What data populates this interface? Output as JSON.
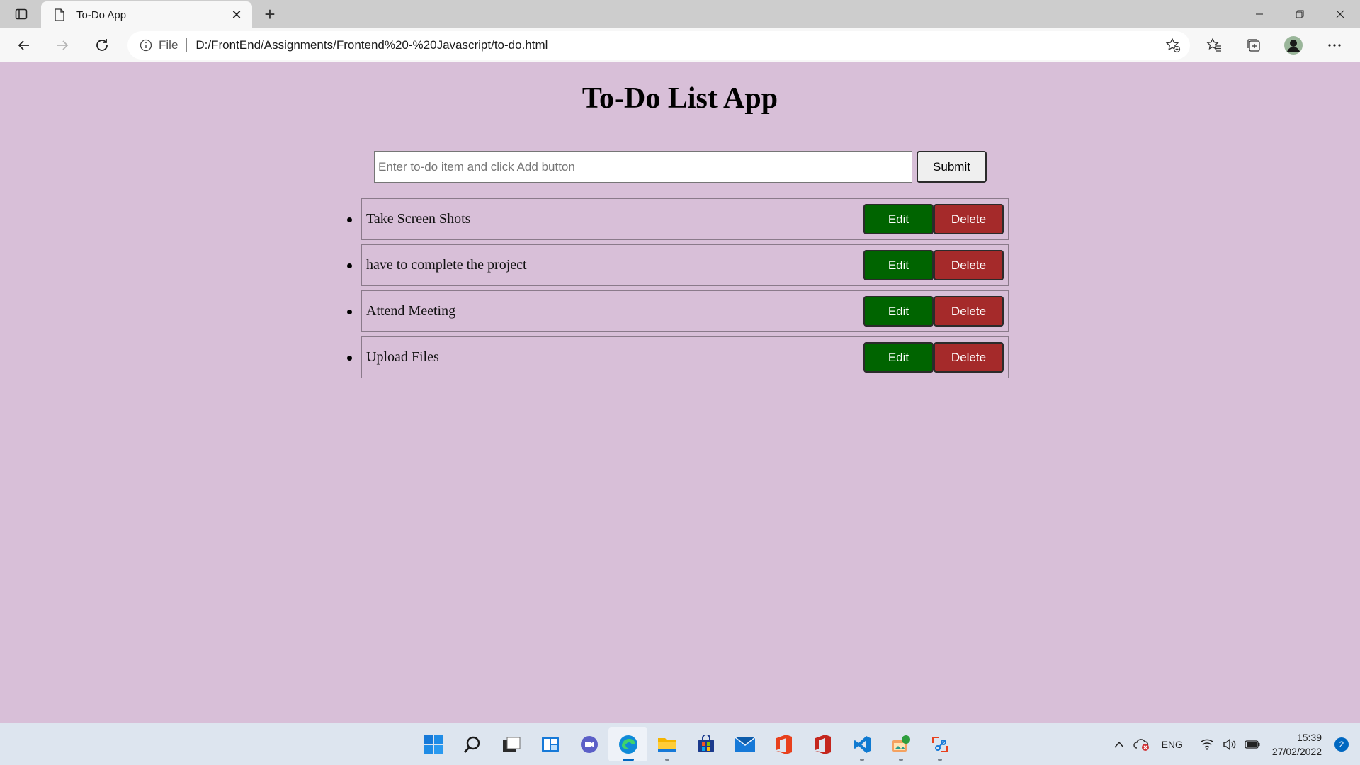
{
  "browser": {
    "tab_title": "To-Do App",
    "address_scheme": "File",
    "address_url": "D:/FrontEnd/Assignments/Frontend%20-%20Javascript/to-do.html"
  },
  "app": {
    "title": "To-Do List App",
    "input_placeholder": "Enter to-do item and click Add button",
    "input_value": "",
    "submit_label": "Submit",
    "edit_label": "Edit",
    "delete_label": "Delete",
    "items": [
      {
        "text": "Take Screen Shots"
      },
      {
        "text": "have to complete the project"
      },
      {
        "text": "Attend Meeting"
      },
      {
        "text": "Upload Files"
      }
    ]
  },
  "taskbar": {
    "apps": [
      "start-icon",
      "search-icon",
      "task-view-icon",
      "widgets-icon",
      "teams-chat-icon",
      "edge-icon",
      "file-explorer-icon",
      "store-icon",
      "mail-icon",
      "office-icon",
      "office-app-icon",
      "vscode-icon",
      "photos-icon",
      "snipping-tool-icon"
    ],
    "language": "ENG",
    "time": "15:39",
    "date": "27/02/2022",
    "notification_count": "2"
  },
  "colors": {
    "page_background": "#d8bfd8",
    "edit_button": "#006400",
    "delete_button": "#a52a2a"
  }
}
